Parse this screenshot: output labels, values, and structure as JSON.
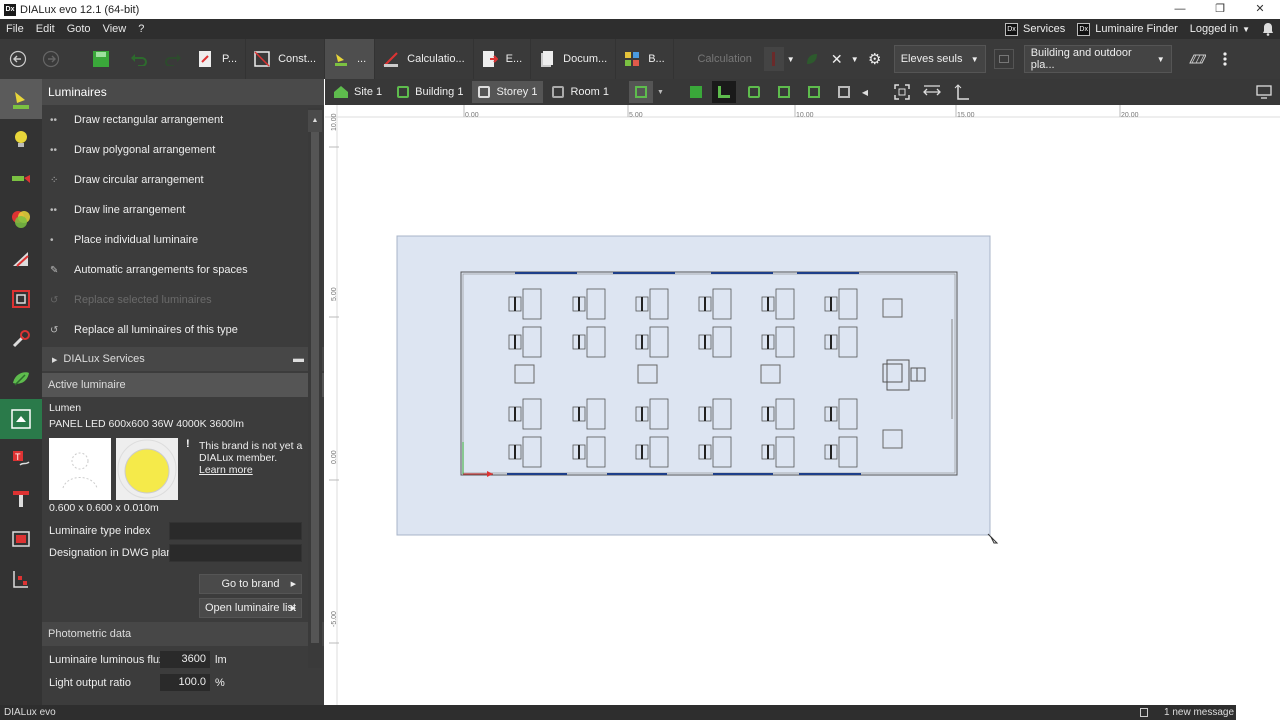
{
  "window": {
    "title": "DIALux evo 12.1  (64-bit)",
    "logo": "Dx",
    "minimize": "—",
    "restore": "❐",
    "close": "✕"
  },
  "menu": {
    "items": [
      "File",
      "Edit",
      "Goto",
      "View",
      "?"
    ],
    "services": "Services",
    "luminaire_finder": "Luminaire Finder",
    "logged_in": "Logged in"
  },
  "toolbar": {
    "p_label": "P...",
    "construction_label": "Const...",
    "light_label": "...",
    "calculation_label": "Calculatio...",
    "export_label": "E...",
    "documentation_label": "Docum...",
    "bim_label": "B...",
    "calculation_button": "Calculation",
    "view_mode": "Eleves seuls",
    "planning_mode": "Building and outdoor pla..."
  },
  "panel": {
    "title": "Luminaires",
    "items": [
      {
        "label": "Draw rectangular arrangement",
        "icon": "••"
      },
      {
        "label": "Draw polygonal arrangement",
        "icon": "••"
      },
      {
        "label": "Draw circular arrangement",
        "icon": "⁘"
      },
      {
        "label": "Draw line arrangement",
        "icon": "••"
      },
      {
        "label": "Place individual luminaire",
        "icon": "•"
      },
      {
        "label": "Automatic arrangements for spaces",
        "icon": "✎"
      },
      {
        "label": "Replace selected luminaires",
        "icon": "↺"
      },
      {
        "label": "Replace all luminaires of this type",
        "icon": "↺"
      }
    ],
    "dialux_services": "DIALux Services",
    "active_luminaire": "Active luminaire",
    "manufacturer": "Lumen",
    "product": "PANEL LED 600x600 36W 4000K 3600lm",
    "brand_note": "This brand is not yet a DIALux member.",
    "learn_more": "Learn more",
    "dimensions": "0.600 x 0.600 x 0.010m",
    "type_index_label": "Luminaire type index",
    "dwg_label": "Designation in DWG plan",
    "go_to_brand": "Go to brand",
    "open_list": "Open luminaire list",
    "photometric": "Photometric data",
    "flux_label": "Luminaire luminous flux",
    "flux_value": "3600",
    "flux_unit": "lm",
    "lor_label": "Light output ratio",
    "lor_value": "100.0",
    "lor_unit": "%"
  },
  "viewtabs": {
    "site": "Site 1",
    "building": "Building 1",
    "storey": "Storey 1",
    "room": "Room 1"
  },
  "ruler": {
    "x_ticks": [
      "0.00",
      "5.00",
      "10.00",
      "15.00",
      "20.00"
    ],
    "y_ticks": [
      "10.00",
      "5.00",
      "0.00",
      "-5.00"
    ]
  },
  "status": {
    "app": "DIALux evo",
    "message": "1 new message"
  }
}
